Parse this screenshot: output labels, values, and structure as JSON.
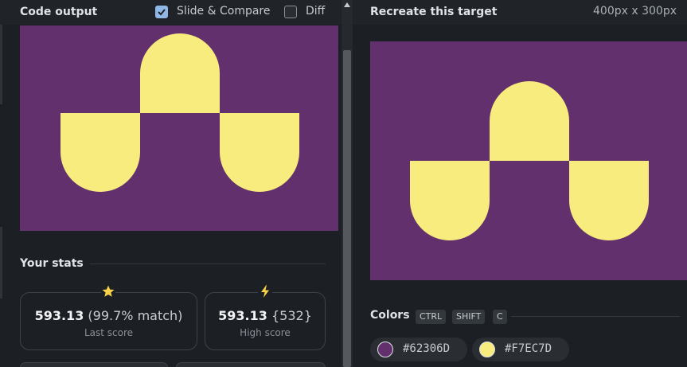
{
  "colors": {
    "background": "#62306D",
    "shape": "#F7EC7D",
    "accent_star": "#f8d24a",
    "checkbox_checked": "#8fb8e8"
  },
  "left_panel": {
    "title": "Code output",
    "options": [
      {
        "label": "Slide & Compare",
        "checked": true
      },
      {
        "label": "Diff",
        "checked": false
      }
    ],
    "stats": {
      "title": "Your stats",
      "last": {
        "value": "593.13",
        "detail": "(99.7% match)",
        "label": "Last score",
        "icon": "star-icon"
      },
      "high": {
        "value": "593.13",
        "detail": "{532}",
        "label": "High score",
        "icon": "lightning-icon"
      }
    }
  },
  "right_panel": {
    "title": "Recreate this target",
    "dimensions": "400px x 300px",
    "colors_title": "Colors",
    "shortcut_keys": [
      "CTRL",
      "SHIFT",
      "C"
    ],
    "swatches": [
      {
        "hex": "#62306D",
        "label": "#62306D"
      },
      {
        "hex": "#F7EC7D",
        "label": "#F7EC7D"
      }
    ]
  }
}
